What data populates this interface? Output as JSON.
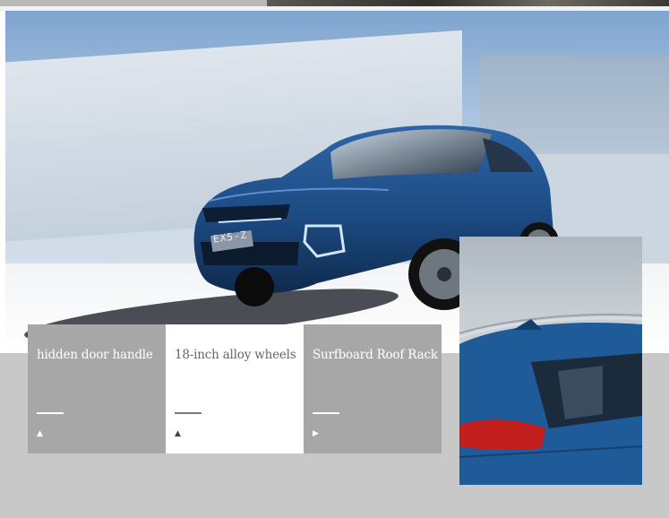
{
  "colors": {
    "car_blue": "#1f4f86",
    "tab_inactive": "#a7a7a7",
    "tab_active": "#ffffff",
    "band": "#c8c8c8",
    "drl_light": "#cfe7ff",
    "tail_light": "#c41f1f"
  },
  "hero": {
    "plate_text": "EX5-Z",
    "logo": "brand-logo-icon"
  },
  "features": [
    {
      "label": "hidden door handle",
      "active": false,
      "indicator": "up-arrow-icon"
    },
    {
      "label": "18-inch alloy wheels",
      "active": true,
      "indicator": "up-arrow-icon"
    },
    {
      "label": "Surfboard Roof Rack",
      "active": false,
      "indicator": "right-arrow-icon"
    }
  ],
  "icons": {
    "up": "▲",
    "right": "▶"
  }
}
